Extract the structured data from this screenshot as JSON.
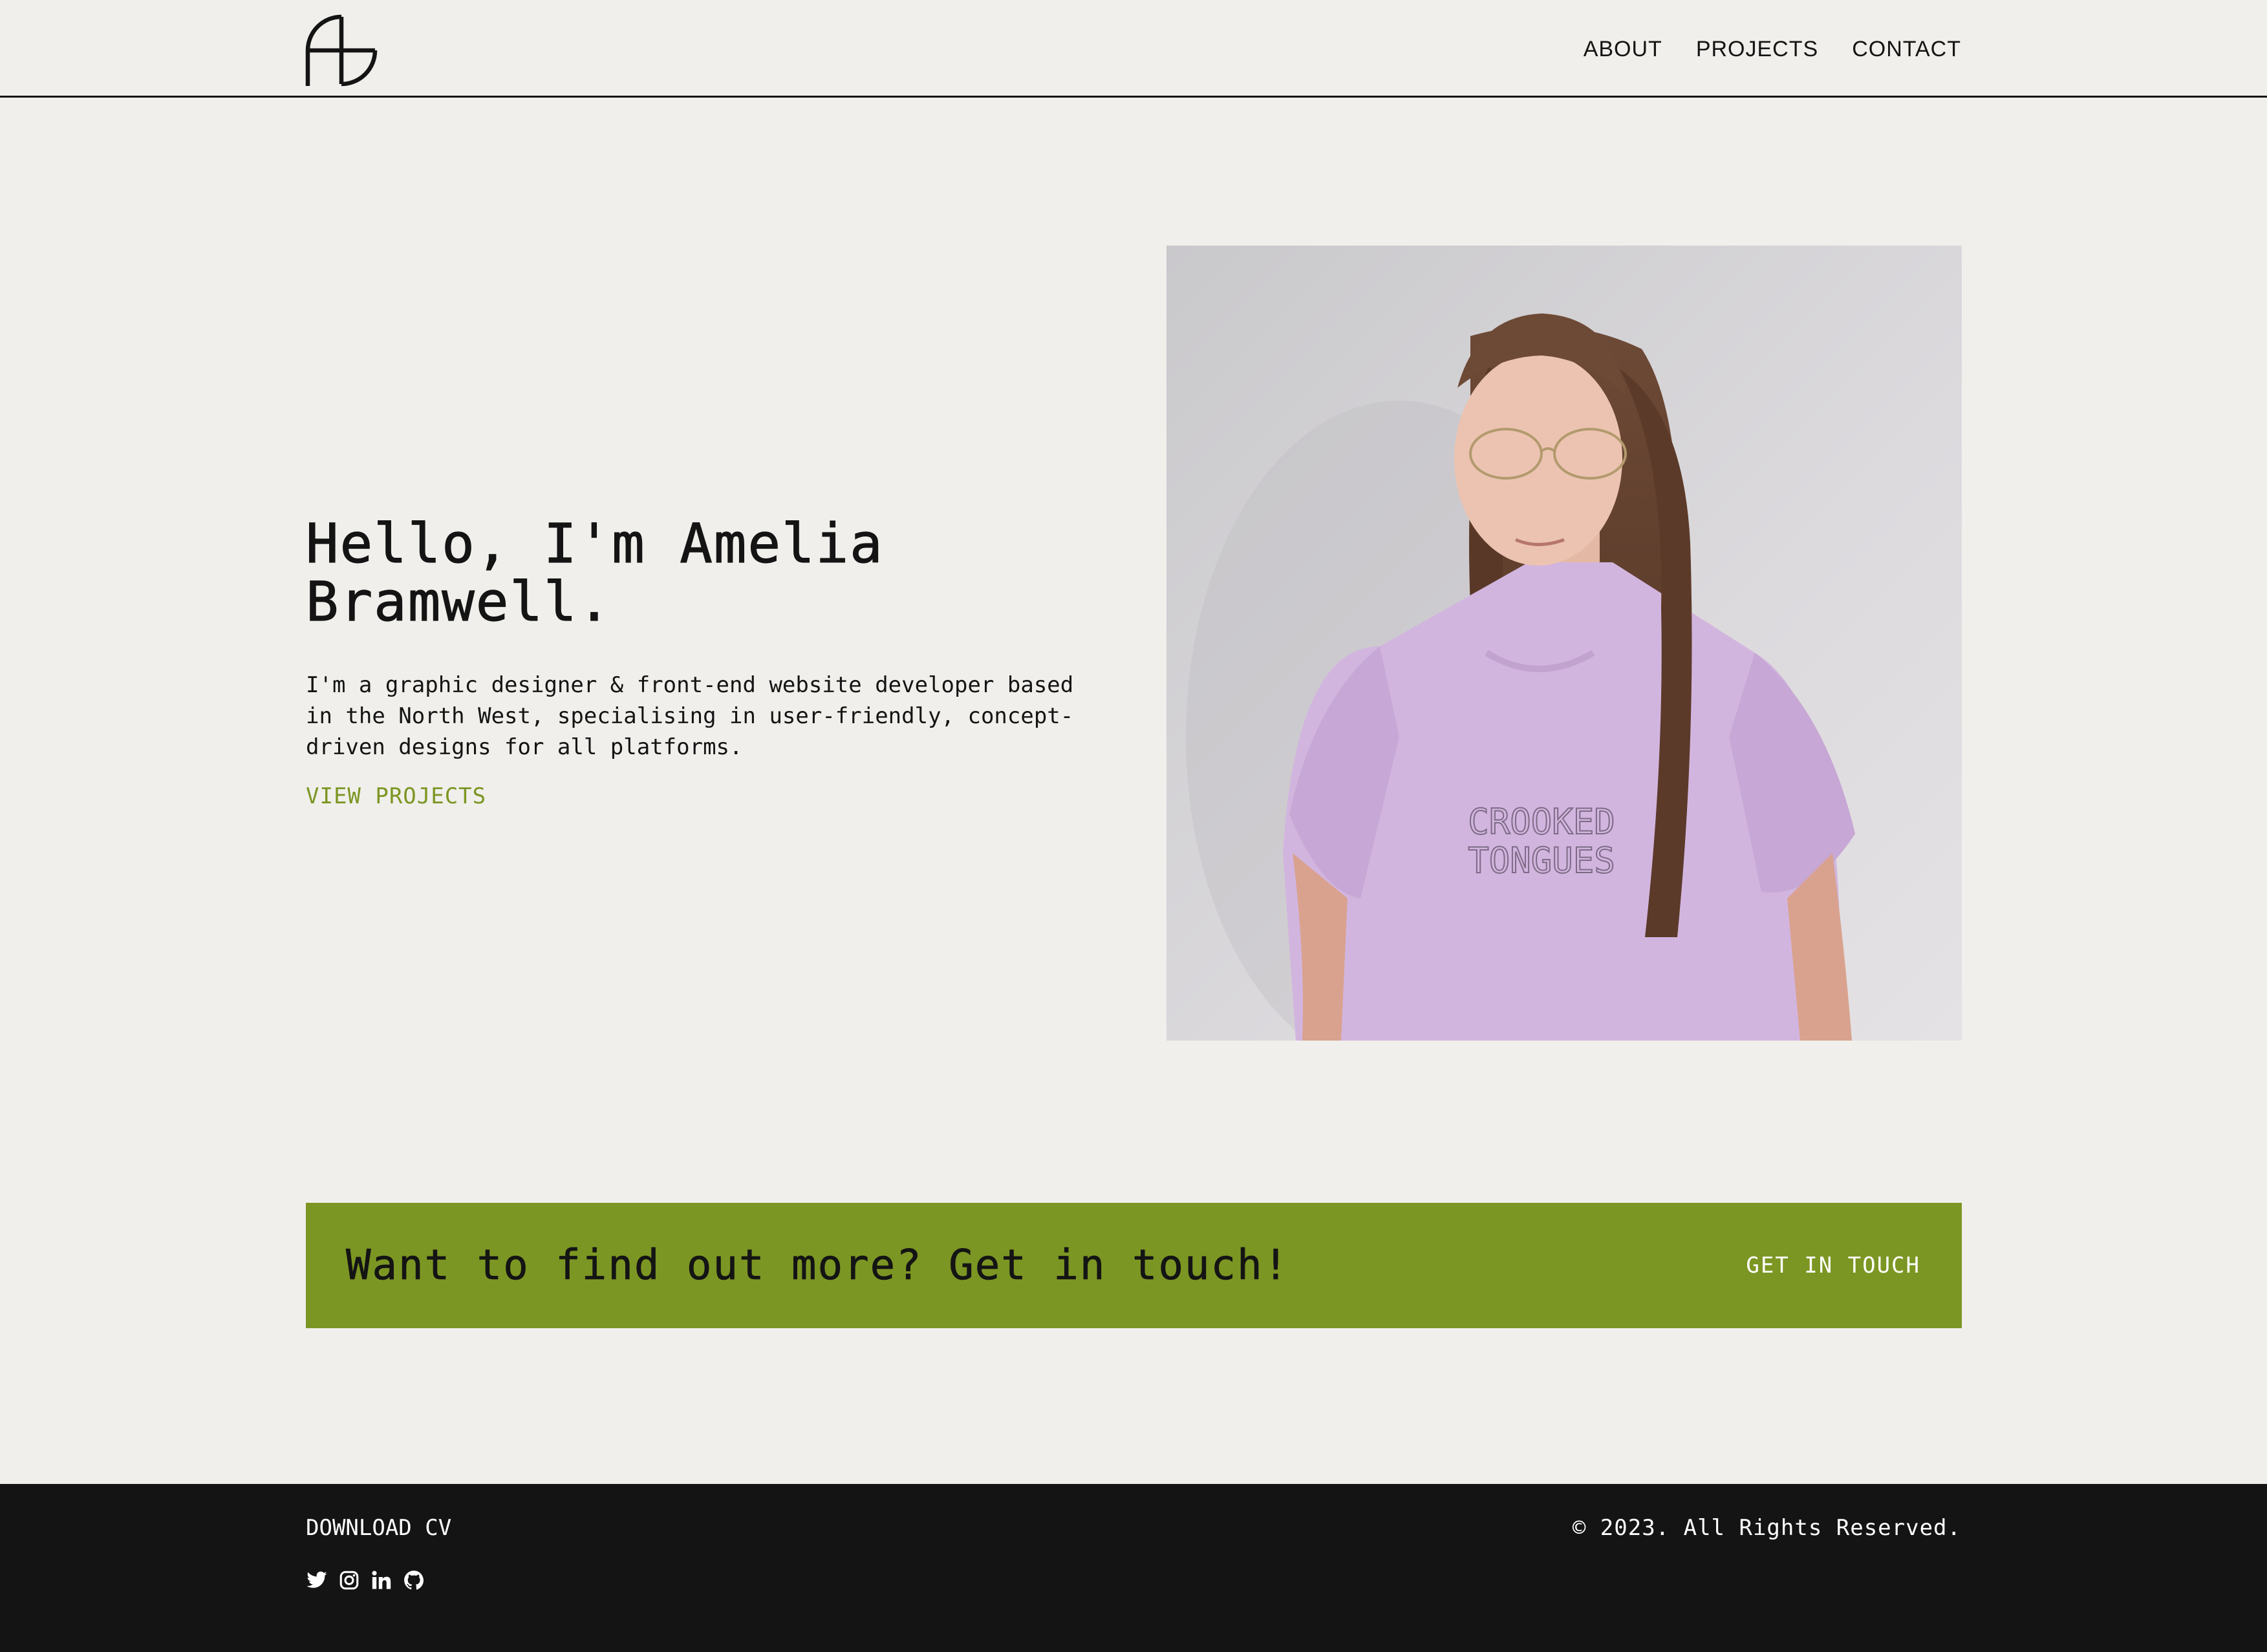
{
  "header": {
    "logo": "ab-monogram-logo",
    "nav": [
      {
        "label": "ABOUT"
      },
      {
        "label": "PROJECTS"
      },
      {
        "label": "CONTACT"
      }
    ]
  },
  "hero": {
    "title": "Hello, I'm Amelia Bramwell.",
    "description": "I'm a graphic designer & front-end website developer based in the North West, specialising in user-friendly, concept-driven designs for all platforms.",
    "link_label": "VIEW PROJECTS",
    "photo": {
      "subject": "portrait-photo",
      "shirt_print": "CROOKED TONGUES"
    }
  },
  "cta": {
    "text": "Want to find out more? Get in touch!",
    "button_label": "GET IN TOUCH"
  },
  "footer": {
    "download_label": "DOWNLOAD CV",
    "copyright": "© 2023. All Rights Reserved.",
    "socials": [
      "twitter-icon",
      "instagram-icon",
      "linkedin-icon",
      "github-icon"
    ]
  },
  "colors": {
    "background": "#f0efeb",
    "text": "#141414",
    "accent": "#7c9623",
    "footer": "#141414"
  }
}
